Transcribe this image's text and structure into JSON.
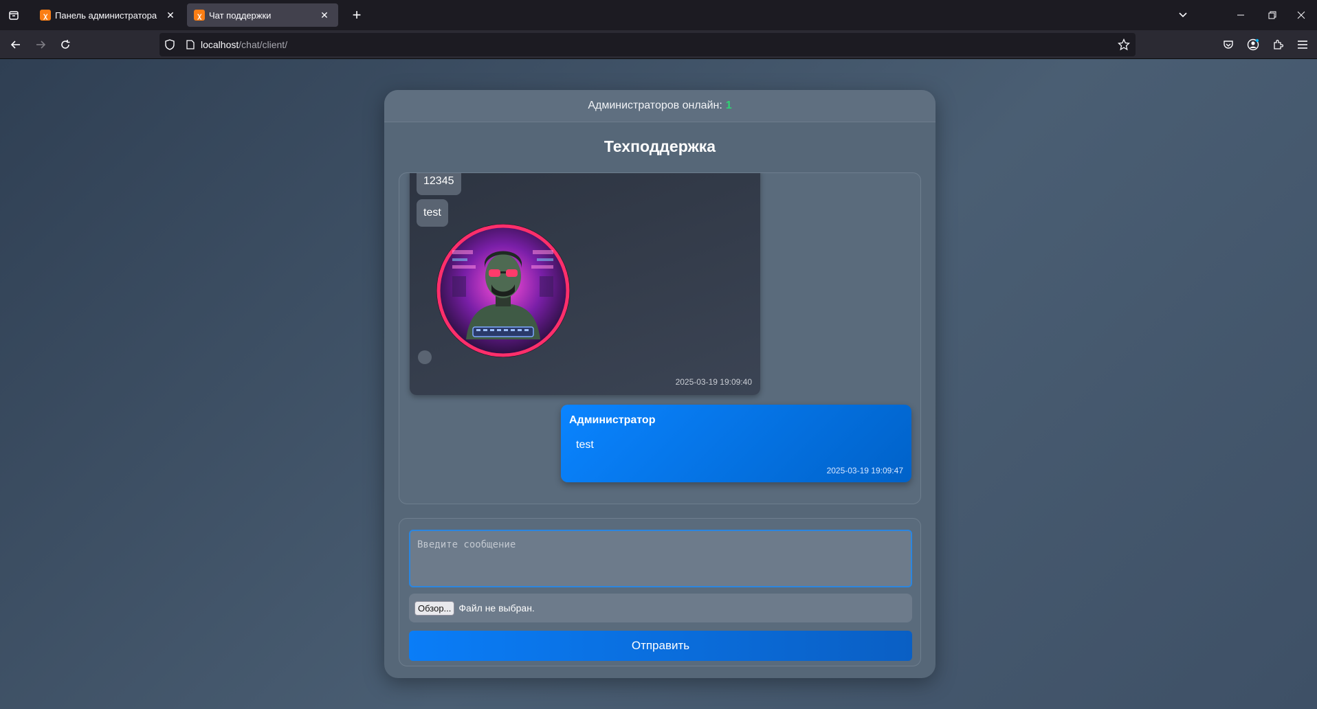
{
  "browser": {
    "tabs": [
      {
        "title": "Панель администратора",
        "active": false
      },
      {
        "title": "Чат поддержки",
        "active": true
      }
    ],
    "url_host": "localhost",
    "url_path": "/chat/client/"
  },
  "chat": {
    "online_label": "Администраторов онлайн:",
    "online_count": "1",
    "title": "Техподдержка",
    "user_messages": [
      "12345",
      "test"
    ],
    "user_timestamp": "2025-03-19 19:09:40",
    "admin_message": {
      "author": "Администратор",
      "text": "test",
      "timestamp": "2025-03-19 19:09:47"
    },
    "input_placeholder": "Введите сообщение",
    "browse_label": "Обзор...",
    "no_file_label": "Файл не выбран.",
    "send_label": "Отправить"
  },
  "colors": {
    "accent": "#0a84ff",
    "online": "#2ed573"
  }
}
